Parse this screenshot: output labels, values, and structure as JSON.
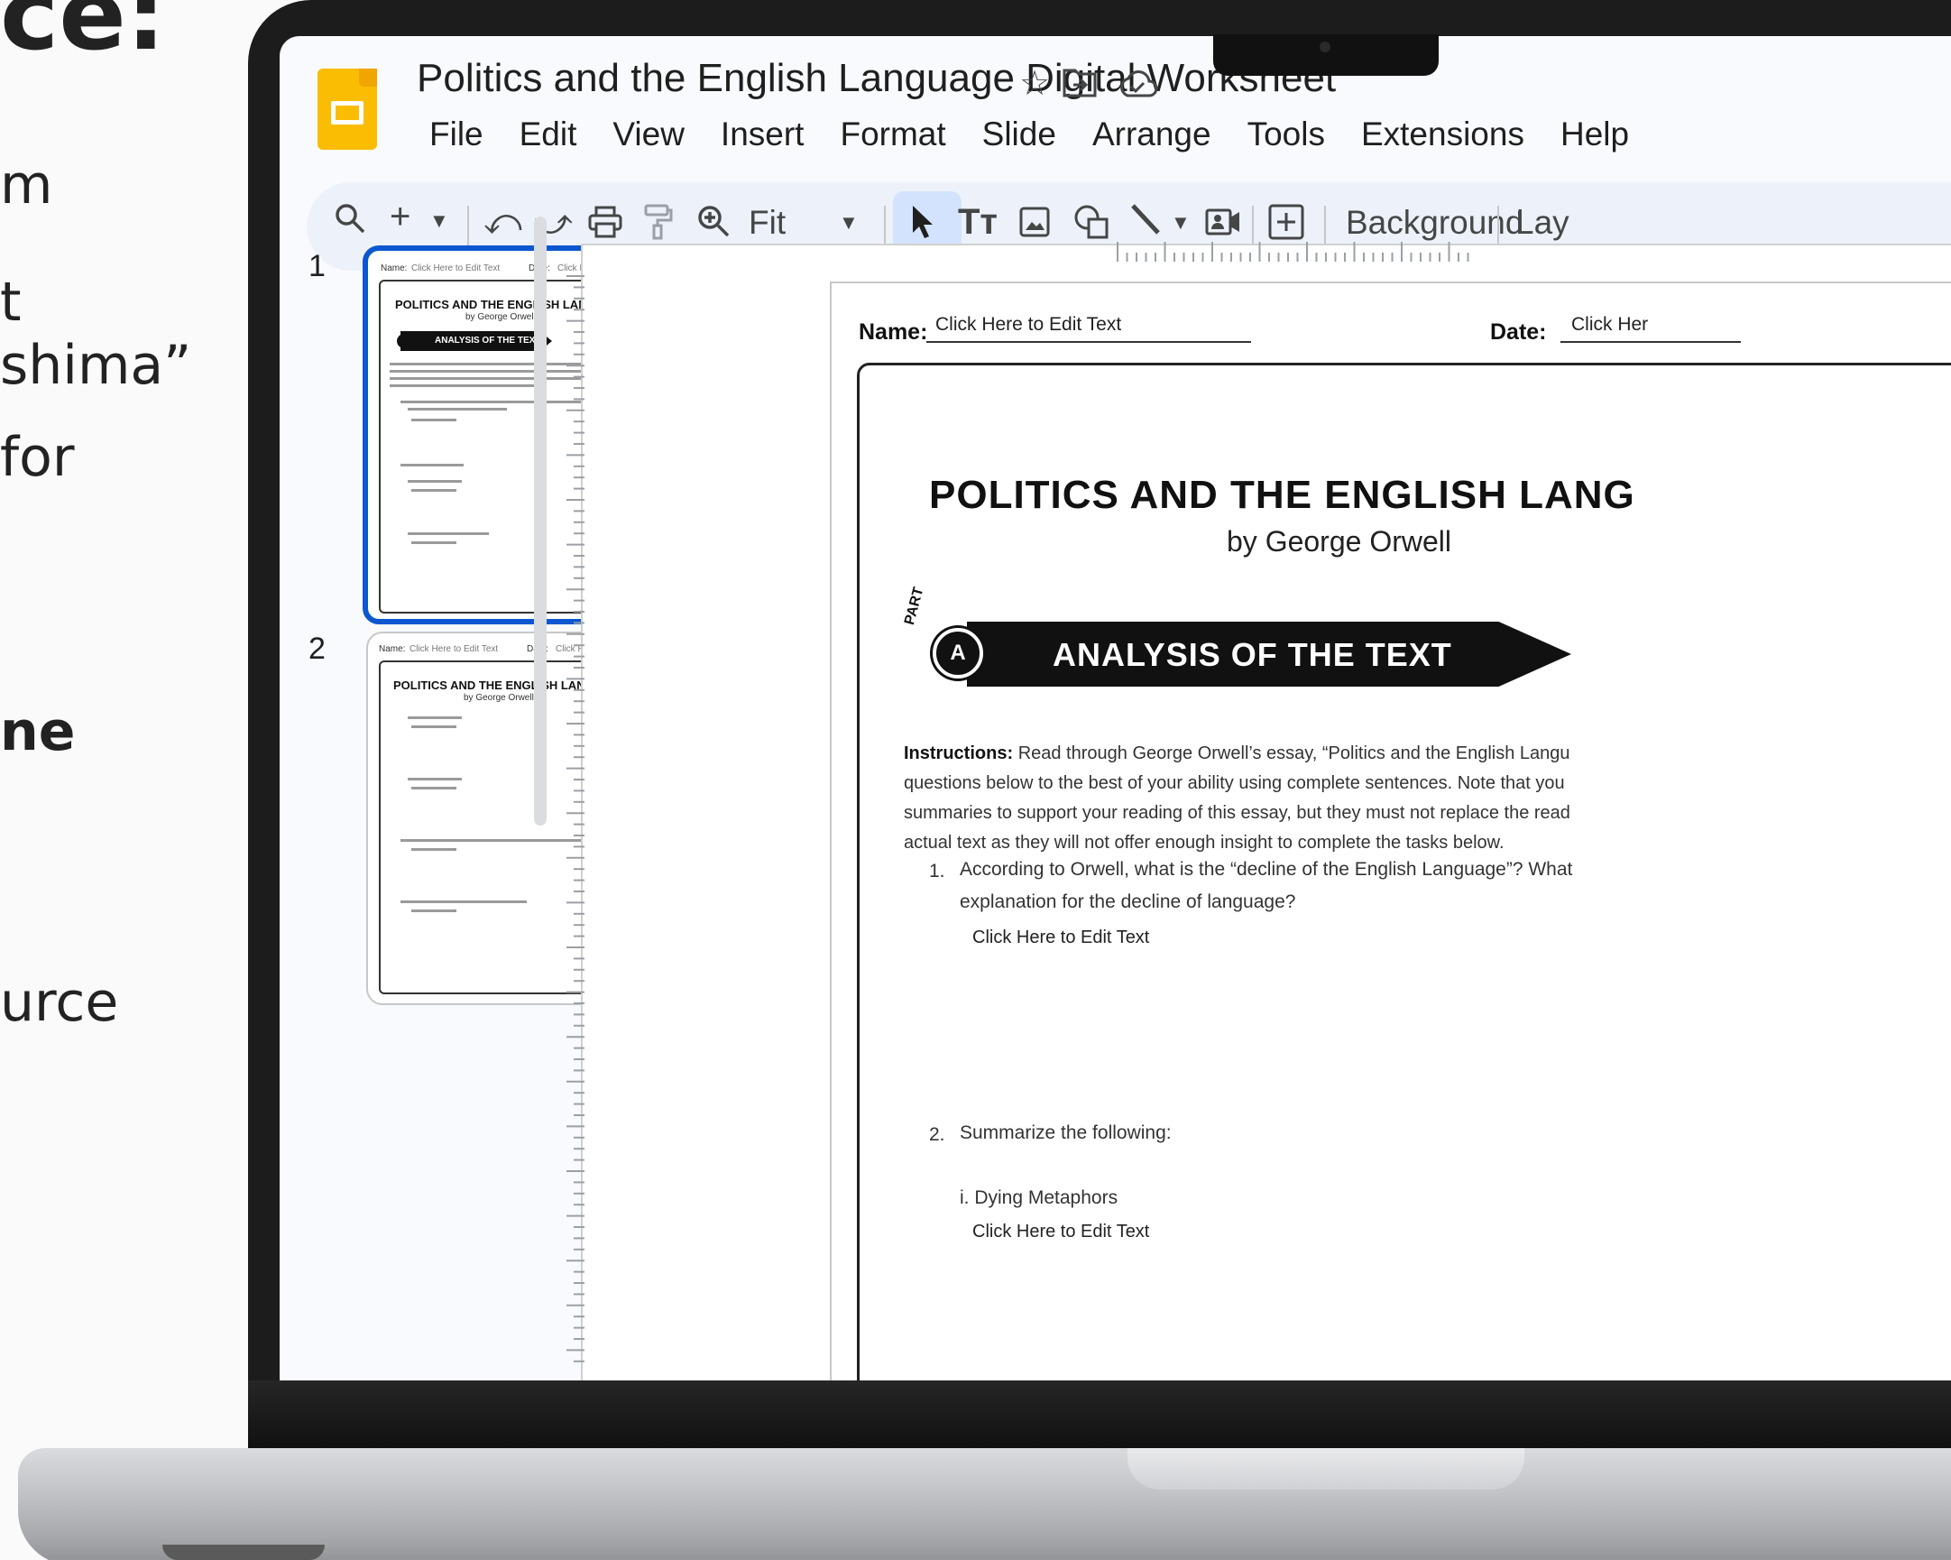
{
  "left_page_fragments": [
    {
      "text": "ce:",
      "style": "big"
    },
    {
      "text": "m",
      "style": "normal"
    },
    {
      "text": "t",
      "style": "normal"
    },
    {
      "text": "shima”",
      "style": "normal"
    },
    {
      "text": "for",
      "style": "normal"
    },
    {
      "text": "ne",
      "style": "bold"
    },
    {
      "text": "urce",
      "style": "normal"
    }
  ],
  "app": {
    "doc_title": "Politics and the English Language Digital Worksheet",
    "menu": [
      "File",
      "Edit",
      "View",
      "Insert",
      "Format",
      "Slide",
      "Arrange",
      "Tools",
      "Extensions",
      "Help"
    ],
    "header_icons": [
      "star-icon",
      "move-to-folder-icon",
      "cloud-saved-icon"
    ],
    "accent_color": "#0b57d0",
    "logo_color": "#fbbc04"
  },
  "toolbar": {
    "zoom_label": "Fit",
    "background_label": "Background",
    "layout_label": "Lay",
    "icons": [
      "search-icon",
      "new-slide-icon",
      "dropdown-icon",
      "undo-icon",
      "redo-icon",
      "print-icon",
      "paint-format-icon",
      "zoom-icon",
      "select-cursor-icon",
      "text-box-icon",
      "image-icon",
      "shape-icon",
      "line-icon",
      "video-icon",
      "comment-add-icon"
    ]
  },
  "filmstrip": {
    "slides": [
      {
        "number": "1",
        "selected": true,
        "name_label": "Name:",
        "name_value": "Click Here to Edit Text",
        "date_label": "Date:",
        "date_value": "Click Here to Edit Text",
        "title": "POLITICS AND THE ENGLISH LANGUAGE",
        "author": "by George Orwell",
        "banner": "ANALYSIS OF THE TEXT"
      },
      {
        "number": "2",
        "selected": false,
        "name_label": "Name:",
        "name_value": "Click Here to Edit Text",
        "date_label": "Date:",
        "date_value": "Click Here to Edit Text",
        "title": "POLITICS AND THE ENGLISH LANGUAGE",
        "author": "by George Orwell"
      }
    ]
  },
  "slide": {
    "name_label": "Name:",
    "name_value": "Click Here to Edit Text",
    "date_label": "Date:",
    "date_value": "Click Her",
    "title": "POLITICS AND THE ENGLISH LANG",
    "author": "by George Orwell",
    "part_label": "PART",
    "part_letter": "A",
    "banner": "ANALYSIS OF THE TEXT",
    "instructions_label": "Instructions:",
    "instructions_lines": [
      "Read through George Orwell’s essay, “Politics and the English Langu",
      "questions below to the best of your ability using complete sentences. Note that you",
      "summaries to support your reading of this essay, but they must not replace the read",
      "actual text as they will not offer enough insight to complete the tasks below."
    ],
    "questions": [
      {
        "number": "1.",
        "lines": [
          "According to Orwell, what is the “decline of the English Language”? What",
          "explanation for the decline of language?"
        ],
        "answer": "Click Here to Edit Text"
      },
      {
        "number": "2.",
        "lines": [
          "Summarize the following:"
        ],
        "sub": "i. Dying Metaphors",
        "answer": "Click Here to Edit Text"
      }
    ]
  }
}
